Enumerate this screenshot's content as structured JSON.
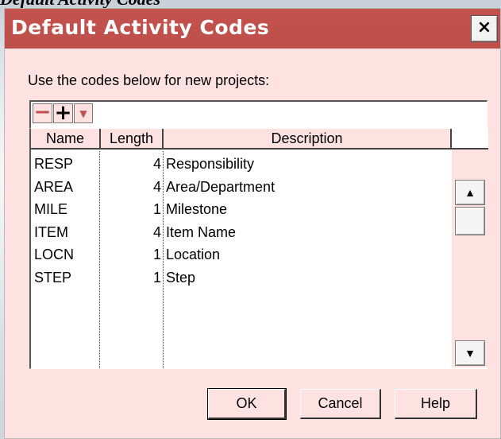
{
  "caption": "Default Activity Codes",
  "window": {
    "title": "Default Activity Codes",
    "close_label": "×",
    "titlebar_color": "#c0504d",
    "body_color": "#fde2e1"
  },
  "instruction": "Use the codes below for new projects:",
  "toolbar": {
    "remove_label": "−",
    "add_label": "+",
    "dropdown_label": "▼"
  },
  "table": {
    "headers": [
      "Name",
      "Length",
      "Description"
    ],
    "rows": [
      {
        "name": "RESP",
        "length": "4",
        "description": "Responsibility"
      },
      {
        "name": "AREA",
        "length": "4",
        "description": "Area/Department"
      },
      {
        "name": "MILE",
        "length": "1",
        "description": "Milestone"
      },
      {
        "name": "ITEM",
        "length": "4",
        "description": "Item Name"
      },
      {
        "name": "LOCN",
        "length": "1",
        "description": "Location"
      },
      {
        "name": "STEP",
        "length": "1",
        "description": "Step"
      }
    ]
  },
  "scrollbar": {
    "up_icon": "▲",
    "down_icon": "▼"
  },
  "buttons": {
    "ok": "OK",
    "cancel": "Cancel",
    "help": "Help"
  }
}
